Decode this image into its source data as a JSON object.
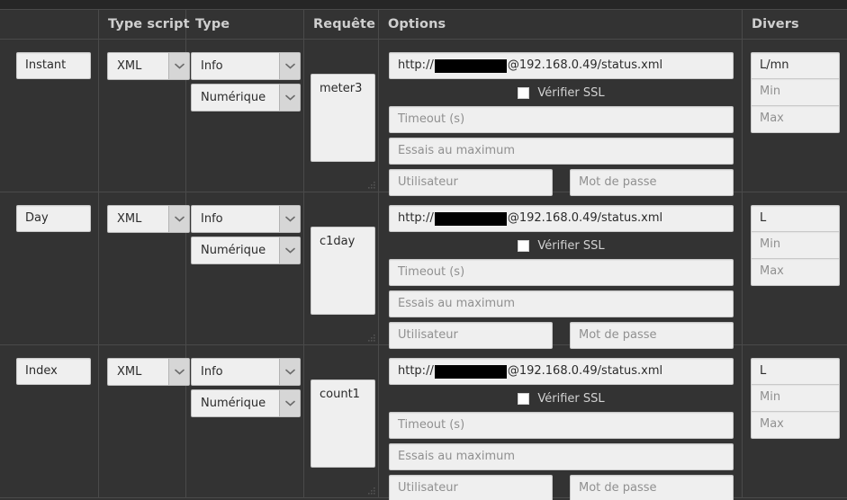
{
  "columns": [
    {
      "key": "name",
      "label": ""
    },
    {
      "key": "script",
      "label": "Type script"
    },
    {
      "key": "type",
      "label": "Type"
    },
    {
      "key": "req",
      "label": "Requête"
    },
    {
      "key": "opt",
      "label": "Options"
    },
    {
      "key": "divers",
      "label": "Divers"
    }
  ],
  "options_fields": {
    "url_prefix": "http://",
    "url_suffix": "@192.168.0.49/status.xml",
    "ssl_label": "Vérifier SSL",
    "timeout_placeholder": "Timeout (s)",
    "essais_placeholder": "Essais au maximum",
    "user_placeholder": "Utilisateur",
    "password_placeholder": "Mot de passe"
  },
  "divers_fields": {
    "min_placeholder": "Min",
    "max_placeholder": "Max"
  },
  "select_options": {
    "script": [
      "XML"
    ],
    "type": [
      "Info"
    ],
    "format": [
      "Numérique"
    ]
  },
  "rows": [
    {
      "name": "Instant",
      "script": "XML",
      "type": "Info",
      "format": "Numérique",
      "requete": "meter3",
      "url_prefix": "http://",
      "url_suffix": "@192.168.0.49/status.xml",
      "ssl_checked": false,
      "timeout": "",
      "essais": "",
      "user": "",
      "password": "",
      "unit": "L/mn",
      "min": "",
      "max": ""
    },
    {
      "name": "Day",
      "script": "XML",
      "type": "Info",
      "format": "Numérique",
      "requete": "c1day",
      "url_prefix": "http://",
      "url_suffix": "@192.168.0.49/status.xml",
      "ssl_checked": false,
      "timeout": "",
      "essais": "",
      "user": "",
      "password": "",
      "unit": "L",
      "min": "",
      "max": ""
    },
    {
      "name": "Index",
      "script": "XML",
      "type": "Info",
      "format": "Numérique",
      "requete": "count1",
      "url_prefix": "http://",
      "url_suffix": "@192.168.0.49/status.xml",
      "ssl_checked": false,
      "timeout": "",
      "essais": "",
      "user": "",
      "password": "",
      "unit": "L",
      "min": "",
      "max": ""
    }
  ],
  "colors": {
    "background": "#333333",
    "border": "#4a4a4a",
    "field_bg": "#efefef",
    "header_text": "#cfcfcf",
    "placeholder": "#909090",
    "redaction": "#000000"
  }
}
